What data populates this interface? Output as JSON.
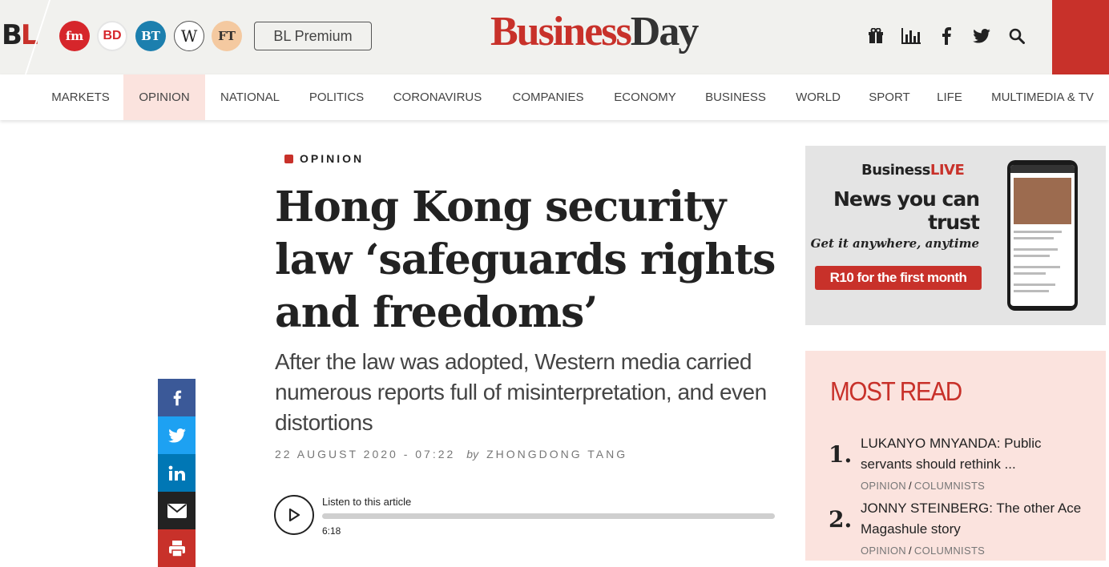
{
  "topbar": {
    "bl_logo": {
      "b": "B",
      "l": "L"
    },
    "publications": [
      {
        "label": "fm",
        "icon": "financial-mail-logo"
      },
      {
        "label": "BD",
        "icon": "business-day-logo"
      },
      {
        "label": "BT",
        "icon": "business-times-logo"
      },
      {
        "label": "W",
        "icon": "wanted-logo"
      },
      {
        "label": "FT",
        "icon": "financial-times-logo"
      }
    ],
    "premium_label": "BL Premium",
    "brand": {
      "business": "Business",
      "day": "Day"
    },
    "icons": [
      "gift-icon",
      "bar-chart-icon",
      "facebook-icon",
      "twitter-icon",
      "search-icon"
    ],
    "accent_color": "#c8312a"
  },
  "nav": {
    "items": [
      {
        "label": "MARKETS"
      },
      {
        "label": "OPINION",
        "active": true
      },
      {
        "label": "NATIONAL"
      },
      {
        "label": "POLITICS"
      },
      {
        "label": "CORONAVIRUS"
      },
      {
        "label": "COMPANIES"
      },
      {
        "label": "ECONOMY"
      },
      {
        "label": "BUSINESS"
      },
      {
        "label": "WORLD"
      },
      {
        "label": "SPORT"
      },
      {
        "label": "LIFE"
      },
      {
        "label": "MULTIMEDIA & TV"
      }
    ]
  },
  "article": {
    "category": "OPINION",
    "headline": "Hong Kong security law ‘safeguards rights and freedoms’",
    "standfirst": "After the law was adopted, Western media carried numerous reports full of misinterpretation, and even distortions",
    "date": "22 AUGUST 2020 - 07:22",
    "by": "by",
    "author": "ZHONGDONG TANG"
  },
  "audio": {
    "label": "Listen to this article",
    "duration": "6:18",
    "progress_fraction": 0
  },
  "share": [
    {
      "icon": "facebook-icon",
      "color": "#3b5998"
    },
    {
      "icon": "twitter-icon",
      "color": "#1da1f2"
    },
    {
      "icon": "linkedin-icon",
      "color": "#0077b5"
    },
    {
      "icon": "email-icon",
      "color": "#222222"
    },
    {
      "icon": "print-icon",
      "color": "#c8312a"
    }
  ],
  "ad": {
    "brand_business": "Business",
    "brand_live": "LIVE",
    "headline": "News you can trust",
    "tagline": "Get it anywhere, anytime",
    "cta": "R10 for the first month"
  },
  "most_read": {
    "title": "MOST READ",
    "items": [
      {
        "num": "1.",
        "title": "LUKANYO MNYANDA: Public servants should rethink ...",
        "section": "OPINION",
        "subsection": "COLUMNISTS"
      },
      {
        "num": "2.",
        "title": "JONNY STEINBERG: The other Ace Magashule story",
        "section": "OPINION",
        "subsection": "COLUMNISTS"
      }
    ]
  }
}
